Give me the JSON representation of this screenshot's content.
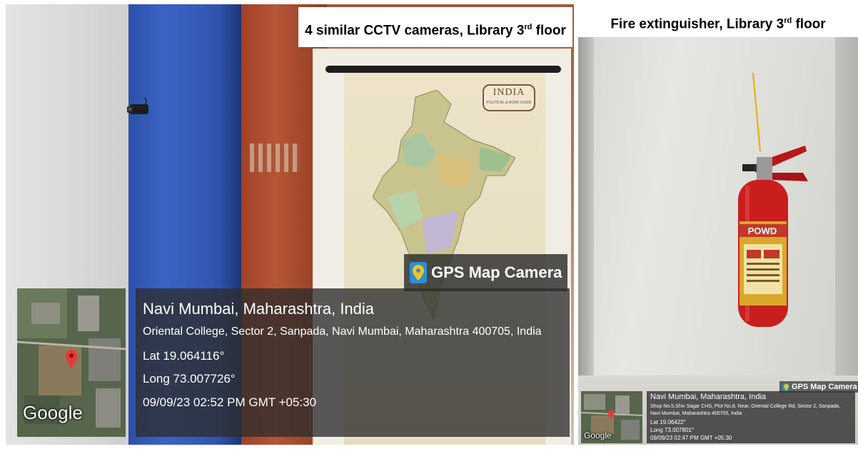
{
  "left_photo": {
    "caption": {
      "main": "4 similar CCTV cameras, Library 3",
      "sup": "rd",
      "tail": " floor"
    },
    "map_title": "INDIA",
    "map_subtitle": "POLITICAL & ROAD GUIDE",
    "gps": {
      "brand": "GPS Map Camera",
      "location": "Navi Mumbai, Maharashtra, India",
      "address": "Oriental College, Sector 2, Sanpada, Navi Mumbai, Maharashtra 400705, India",
      "lat": "Lat 19.064116°",
      "long": "Long 73.007726°",
      "datetime": "09/09/23 02:52 PM GMT +05:30",
      "map_logo": "Google"
    }
  },
  "right_photo": {
    "caption": {
      "main": "Fire extinguisher, Library 3",
      "sup": "rd",
      "tail": " floor"
    },
    "label_text": "POWD",
    "gps": {
      "brand": "GPS Map Camera",
      "location": "Navi Mumbai, Maharashtra, India",
      "address": "Shop No.5,Shiv Sagar CHS, Plot No.8, Near, Oriental College Rd, Sector 2, Sanpada, Navi Mumbai, Maharashtra 400705, India",
      "lat": "Lat 19.06422°",
      "long": "Long 73.007801°",
      "datetime": "09/09/23 02:47 PM GMT +05:30",
      "map_logo": "Google"
    }
  },
  "icons": {
    "pin": "map-pin-icon",
    "gps_app": "gps-map-camera-icon"
  },
  "colors": {
    "pin_red": "#e53935",
    "gps_app_blue": "#2a8fd6",
    "extinguisher_red": "#c81e1e"
  }
}
